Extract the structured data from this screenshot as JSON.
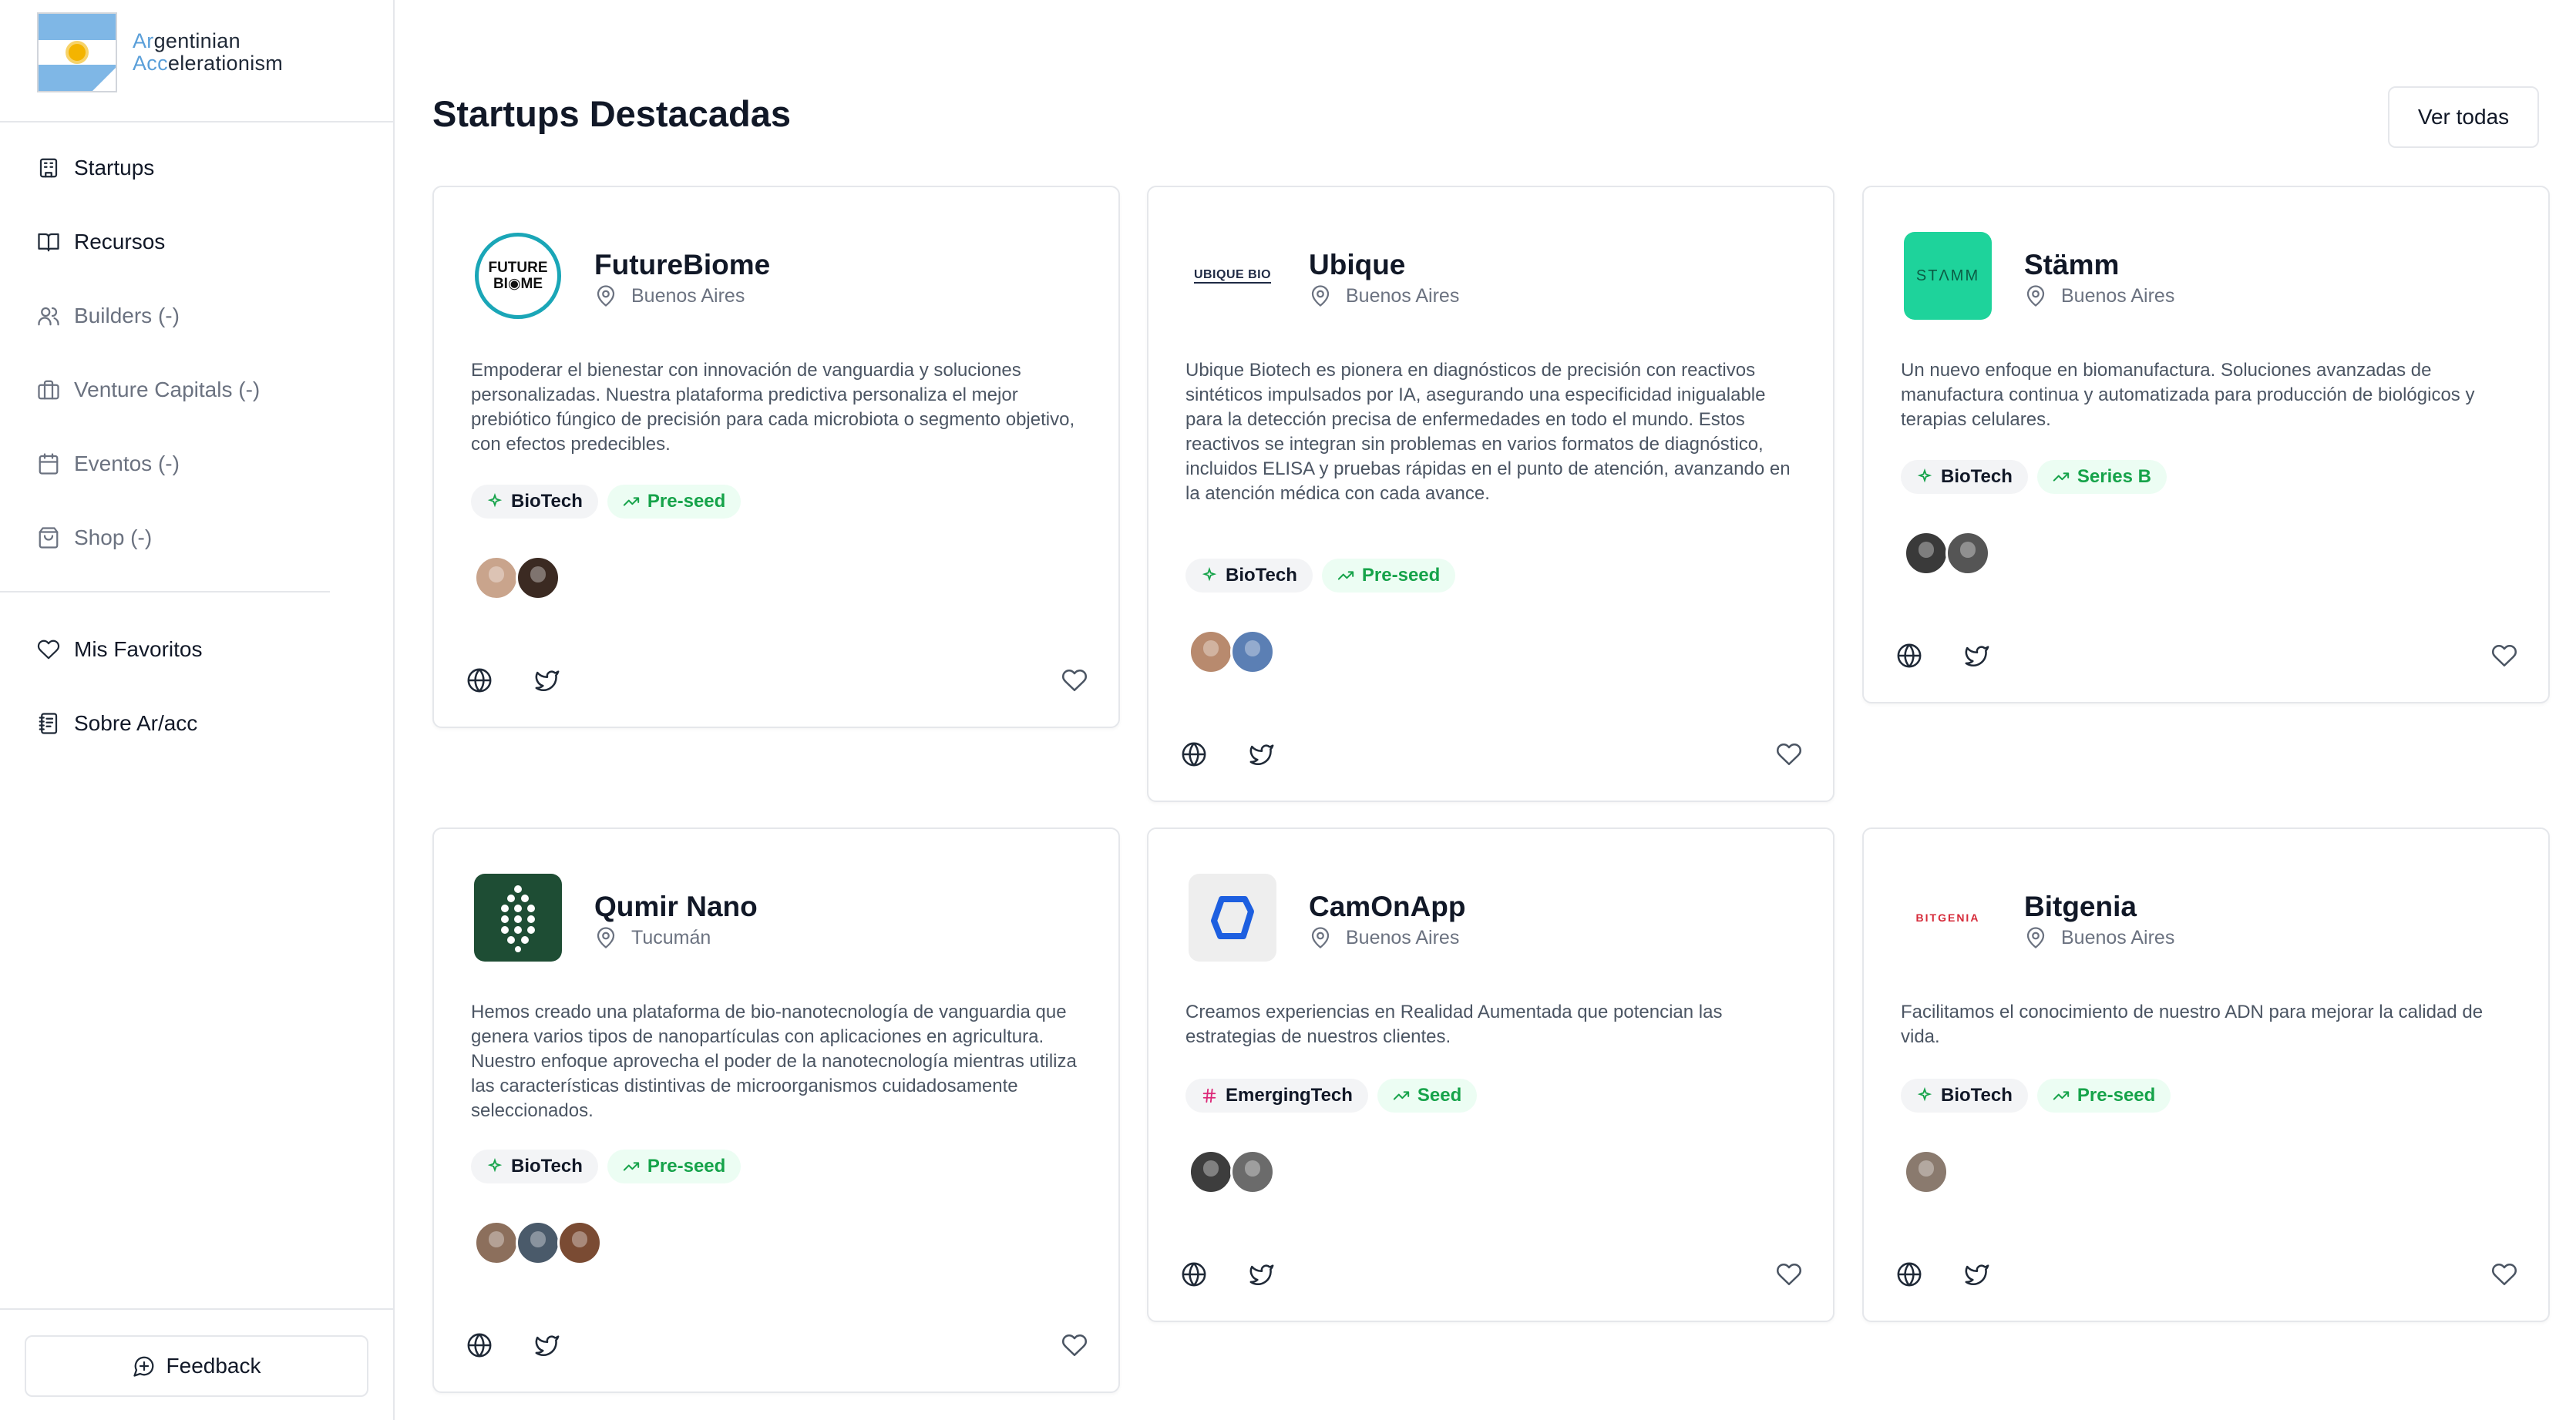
{
  "brand": {
    "line1_hl": "Ar",
    "line1_rest": "gentinian",
    "line2_hl": "Acc",
    "line2_rest": "elerationism"
  },
  "sidebar": {
    "items": [
      {
        "label": "Startups",
        "icon": "building-icon"
      },
      {
        "label": "Recursos",
        "icon": "book-icon"
      },
      {
        "label": "Builders (-)",
        "icon": "users-icon"
      },
      {
        "label": "Venture Capitals (-)",
        "icon": "briefcase-icon"
      },
      {
        "label": "Eventos (-)",
        "icon": "calendar-icon"
      },
      {
        "label": "Shop (-)",
        "icon": "shopping-bag-icon"
      }
    ],
    "secondary": [
      {
        "label": "Mis Favoritos",
        "icon": "heart-icon"
      },
      {
        "label": "Sobre Ar/acc",
        "icon": "notebook-icon"
      }
    ],
    "feedback": "Feedback"
  },
  "main": {
    "title": "Startups Destacadas",
    "view_all": "Ver todas"
  },
  "startups": [
    {
      "name": "FutureBiome",
      "location": "Buenos Aires",
      "logo_text": "FUTURE BI◉ME",
      "description": "Empoderar el bienestar con innovación de vanguardia y soluciones personalizadas. Nuestra plataforma predictiva personaliza el mejor prebiótico fúngico de precisión para cada microbiota o segmento objetivo, con efectos predecibles.",
      "sector": "BioTech",
      "stage": "Pre-seed"
    },
    {
      "name": "Ubique",
      "location": "Buenos Aires",
      "logo_text": "UBIQUE BIO",
      "description": "Ubique Biotech es pionera en diagnósticos de precisión con reactivos sintéticos impulsados por IA, asegurando una especificidad inigualable para la detección precisa de enfermedades en todo el mundo. Estos reactivos se integran sin problemas en varios formatos de diagnóstico, incluidos ELISA y pruebas rápidas en el punto de atención, avanzando en la atención médica con cada avance.",
      "sector": "BioTech",
      "stage": "Pre-seed"
    },
    {
      "name": "Stämm",
      "location": "Buenos Aires",
      "logo_text": "STΛMM",
      "description": "Un nuevo enfoque en biomanufactura. Soluciones avanzadas de manufactura continua y automatizada para producción de biológicos y terapias celulares.",
      "sector": "BioTech",
      "stage": "Series B"
    },
    {
      "name": "Qumir Nano",
      "location": "Tucumán",
      "logo_text": "",
      "description": "Hemos creado una plataforma de bio-nanotecnología de vanguardia que genera varios tipos de nanopartículas con aplicaciones en agricultura. Nuestro enfoque aprovecha el poder de la nanotecnología mientras utiliza las características distintivas de microorganismos cuidadosamente seleccionados.",
      "sector": "BioTech",
      "stage": "Pre-seed"
    },
    {
      "name": "CamOnApp",
      "location": "Buenos Aires",
      "logo_text": "",
      "description": "Creamos experiencias en Realidad Aumentada que potencian las estrategias de nuestros clientes.",
      "sector": "EmergingTech",
      "stage": "Seed"
    },
    {
      "name": "Bitgenia",
      "location": "Buenos Aires",
      "logo_text": "BITGENIA",
      "description": "Facilitamos el conocimiento de nuestro ADN para mejorar la calidad de vida.",
      "sector": "BioTech",
      "stage": "Pre-seed"
    }
  ],
  "colors": {
    "stage_text": "#16a34a",
    "stage_bg": "#ecfdf3",
    "stamm_green": "#1ed39b",
    "qumir_green": "#1e4d34",
    "camon_blue": "#1d5fe0",
    "bitgenia_red": "#d62b3a"
  }
}
